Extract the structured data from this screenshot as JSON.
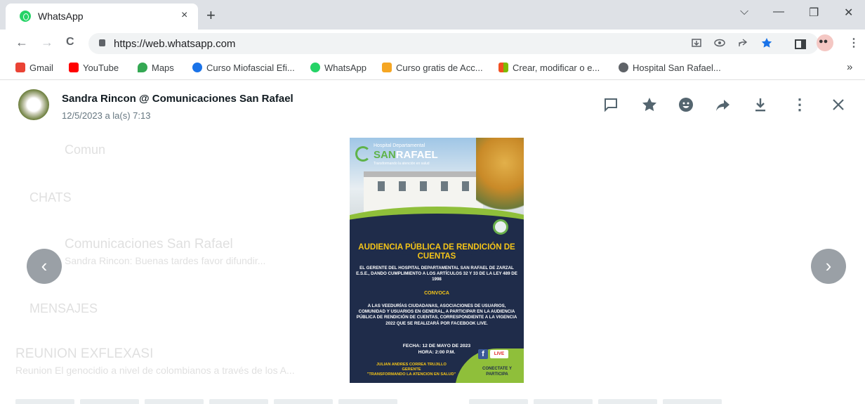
{
  "browser": {
    "tab_title": "WhatsApp",
    "tab_close": "×",
    "new_tab": "+",
    "url": "https://web.whatsapp.com",
    "window_controls": {
      "chevron": "⌵",
      "minimize": "—",
      "restore": "❐",
      "close": "✕"
    },
    "nav": {
      "back": "←",
      "forward": "→",
      "reload": "C"
    },
    "bookmarks": [
      {
        "label": "Gmail",
        "icon": "gmail-icon",
        "color": "#ea4335"
      },
      {
        "label": "YouTube",
        "icon": "youtube-icon",
        "color": "#ff0000"
      },
      {
        "label": "Maps",
        "icon": "maps-icon",
        "color": "#34a853"
      },
      {
        "label": "Curso Miofascial Efi...",
        "icon": "globe-icon",
        "color": "#1a73e8"
      },
      {
        "label": "WhatsApp",
        "icon": "whatsapp-icon",
        "color": "#25d366"
      },
      {
        "label": "Curso gratis de Acc...",
        "icon": "ac-icon",
        "color": "#f5a623"
      },
      {
        "label": "Crear, modificar o e...",
        "icon": "microsoft-icon",
        "color": "#f25022"
      },
      {
        "label": "Hospital San Rafael...",
        "icon": "globe-icon",
        "color": "#5f6368"
      }
    ],
    "bookmarks_more": "»"
  },
  "viewer": {
    "sender": "Sandra Rincon @ Comunicaciones San Rafael",
    "timestamp": "12/5/2023 a la(s) 7:13",
    "prev_arrow": "‹",
    "next_arrow": "›"
  },
  "background": {
    "search": "Comun",
    "chats_heading": "CHATS",
    "chat_name": "Comunicaciones San Rafael",
    "chat_preview": "Sandra Rincon: Buenas tardes favor difundir...",
    "messages_heading": "MENSAJES",
    "msg_title": "REUNION EXFLEXASI",
    "msg_preview": "Reunion El genocidio a nivel de colombianos a través de los A..."
  },
  "poster": {
    "logo_small": "Hospital Departamental",
    "logo_brand_a": "SAN",
    "logo_brand_b": "RAFAEL",
    "logo_tag": "Transformando la atención en salud",
    "title": "AUDIENCIA PÚBLICA DE RENDICIÓN DE CUENTAS",
    "body1": "EL GERENTE DEL HOSPITAL DEPARTAMENTAL SAN RAFAEL DE ZARZAL E.S.E., DANDO CUMPLIMIENTO A LOS ARTÍCULOS 32 Y 33 DE LA LEY 489 DE 1998",
    "convoca": "CONVOCA",
    "body2": "A LAS VEEDURÍAS CIUDADANAS, ASOCIACIONES DE USUARIOS, COMUNIDAD Y USUARIOS EN GENERAL, A PARTICIPAR EN LA AUDIENCIA PÚBLICA DE RENDICIÓN DE CUENTAS, CORRESPONDIENTE A LA VIGENCIA 2022 QUE SE REALIZARÁ POR FACEBOOK LIVE.",
    "date": "FECHA: 12 DE MAYO DE 2023",
    "time": "HORA: 2:00 P.M.",
    "signer": "JULIAN ANDRES CORREA TRUJILLO",
    "signer_role": "GERENTE",
    "slogan": "\"TRANSFORMANDO LA ATENCION EN SALUD\"",
    "fb": "f",
    "live": "LIVE",
    "cta": "CONECTATE Y PARTICIPA"
  }
}
